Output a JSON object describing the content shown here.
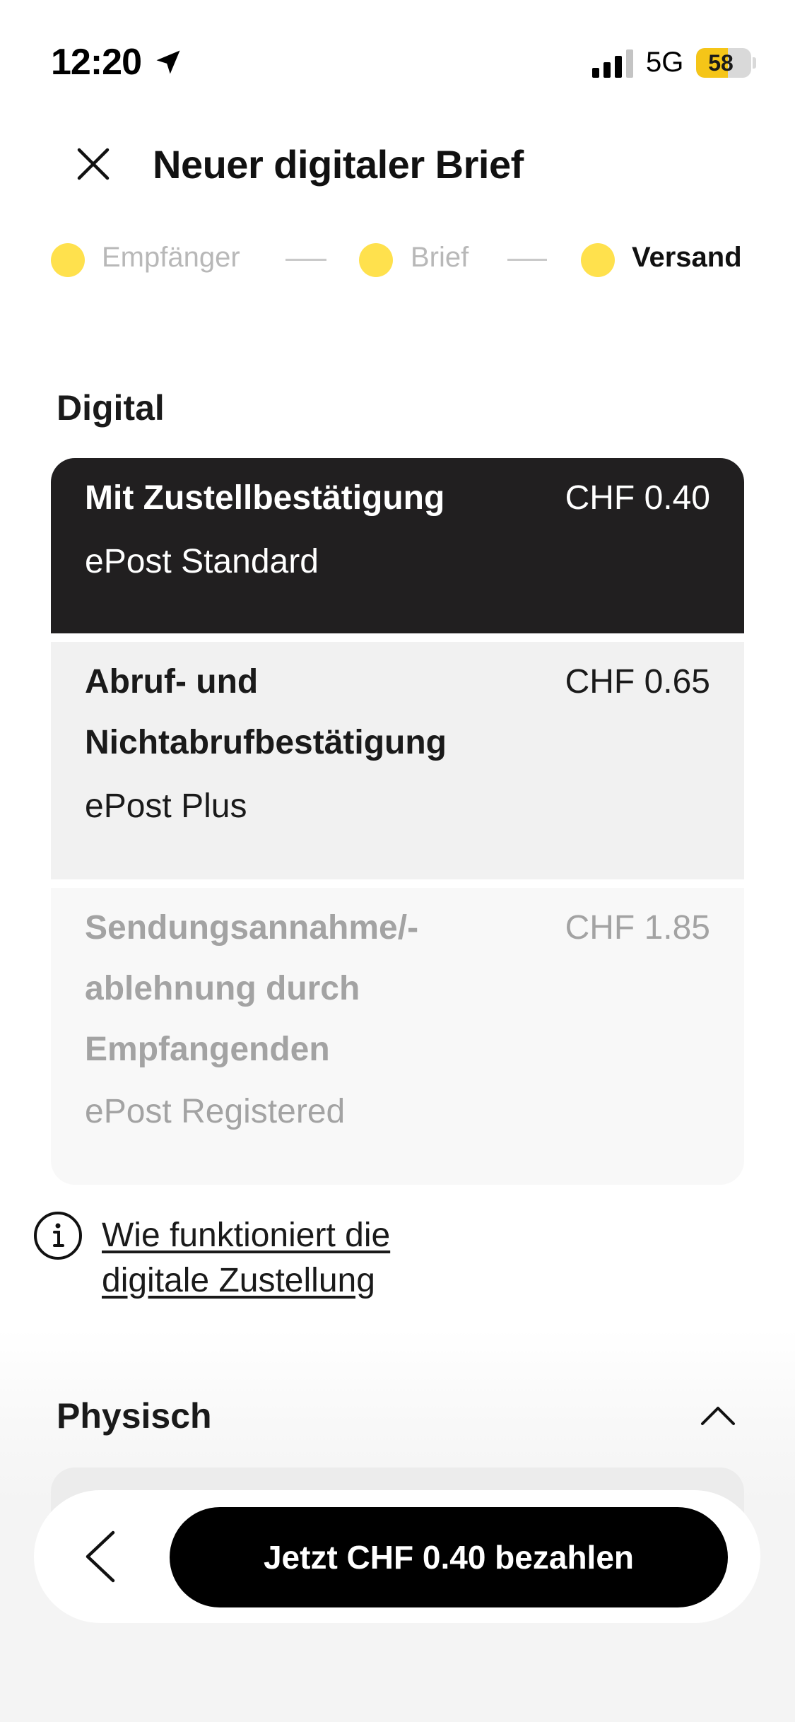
{
  "status_bar": {
    "time": "12:20",
    "network": "5G",
    "battery_level": "58",
    "battery_fraction": 0.58,
    "icons": [
      "location-arrow-icon",
      "signal-icon",
      "battery-icon"
    ]
  },
  "header": {
    "title": "Neuer digitaler Brief",
    "close_icon": "close-icon"
  },
  "stepper": {
    "steps": [
      {
        "label": "Empfänger",
        "active": false
      },
      {
        "label": "Brief",
        "active": false
      },
      {
        "label": "Versand",
        "active": true
      }
    ],
    "dot_color": "#ffe14d"
  },
  "digital": {
    "title": "Digital",
    "options": [
      {
        "title": "Mit Zustellbestätigung",
        "subtitle": "ePost Standard",
        "price": "CHF 0.40",
        "state": "selected"
      },
      {
        "title_line1": "Abruf- und",
        "title_line2": "Nichtabrufbestätigung",
        "subtitle": "ePost Plus",
        "price": "CHF 0.65",
        "state": "available"
      },
      {
        "title_line1": "Sendungsannahme/-",
        "title_line2": "ablehnung durch",
        "title_line3": "Empfangenden",
        "subtitle": "ePost Registered",
        "price": "CHF 1.85",
        "state": "disabled"
      }
    ],
    "info_link_line1": "Wie funktioniert die",
    "info_link_line2": "digitale Zustellung"
  },
  "physisch": {
    "title": "Physisch",
    "expanded": true
  },
  "footer": {
    "pay_label": "Jetzt CHF 0.40 bezahlen"
  },
  "colors": {
    "selected_bg": "#211f20",
    "accent_yellow": "#ffe14d",
    "battery_yellow": "#f5c518",
    "pay_button_bg": "#000000"
  }
}
